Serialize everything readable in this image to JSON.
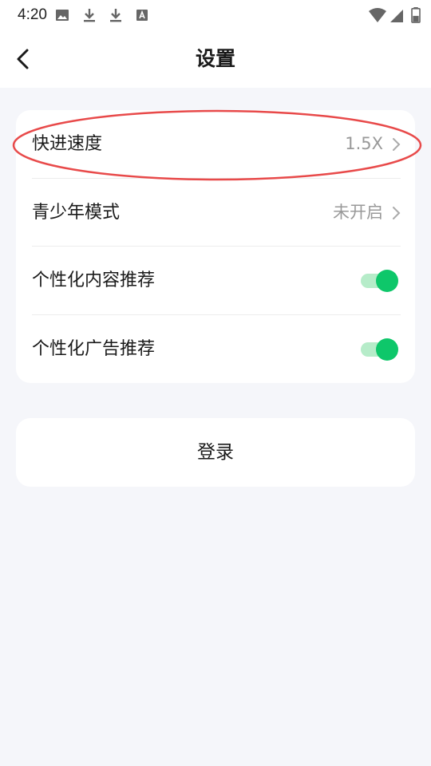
{
  "status_bar": {
    "time": "4:20",
    "left_icons": [
      "image-icon",
      "download-icon",
      "download-icon",
      "text-icon"
    ],
    "right_icons": [
      "wifi-icon",
      "signal-icon",
      "battery-icon"
    ]
  },
  "header": {
    "title": "设置",
    "back_icon": "chevron-left-icon"
  },
  "settings": {
    "rows": [
      {
        "label": "快进速度",
        "value": "1.5X",
        "type": "link"
      },
      {
        "label": "青少年模式",
        "value": "未开启",
        "type": "link"
      },
      {
        "label": "个性化内容推荐",
        "type": "toggle",
        "on": true
      },
      {
        "label": "个性化广告推荐",
        "type": "toggle",
        "on": true
      }
    ]
  },
  "login": {
    "label": "登录"
  },
  "colors": {
    "accent_green": "#0ec76a",
    "toggle_track": "#b6ecc9",
    "highlight_red": "#e84a4a",
    "background": "#f5f6fa"
  }
}
